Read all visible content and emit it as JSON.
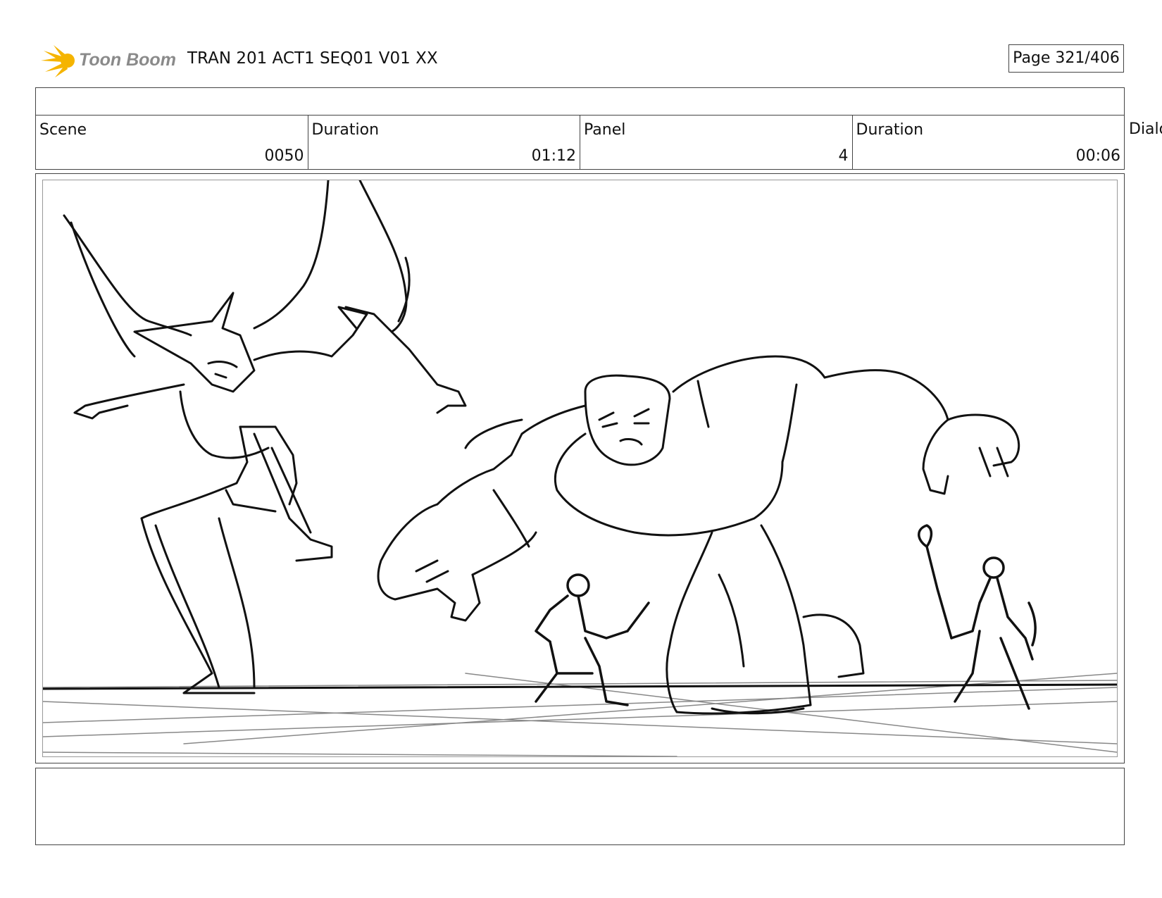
{
  "header": {
    "logo_text": "Toon Boom",
    "document_title": "TRAN 201 ACT1 SEQ01 V01 XX",
    "page_indicator": "Page 321/406"
  },
  "info_row": {
    "scene_label": "Scene",
    "scene_value": "0050",
    "scene_duration_label": "Duration",
    "scene_duration_value": "01:12",
    "panel_label": "Panel",
    "panel_value": "4",
    "panel_duration_label": "Duration",
    "panel_duration_value": "00:06",
    "dialog_label": "Dialo"
  },
  "colors": {
    "logo_accent": "#f5b400",
    "logo_text": "#8a8a8a",
    "border": "#444444",
    "sketch_ink": "#111111"
  }
}
